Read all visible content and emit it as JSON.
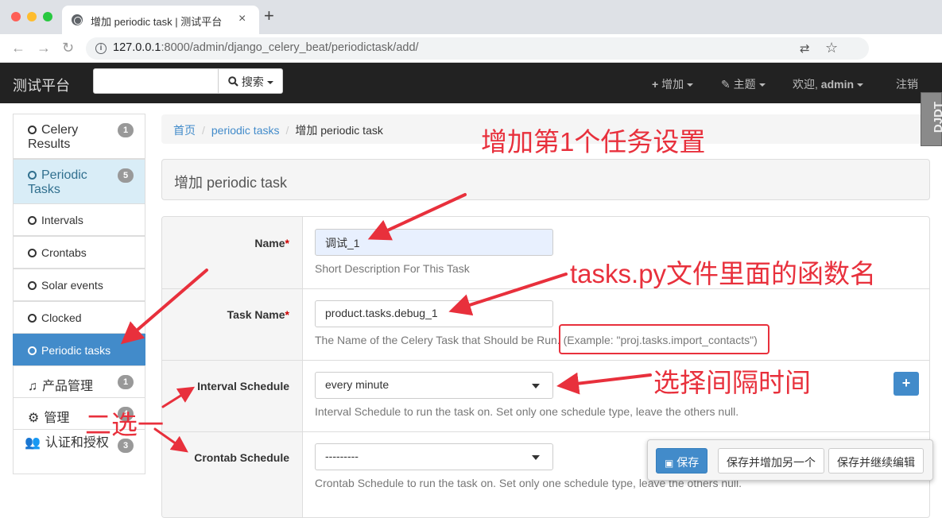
{
  "browser": {
    "tab_title": "增加 periodic task | 测试平台",
    "tab_close": "×",
    "new_tab": "+",
    "url_host": "127.0.0.1",
    "url_rest": ":8000/admin/django_celery_beat/periodictask/add/"
  },
  "navbar": {
    "brand": "测试平台",
    "search_placeholder": "",
    "search_button": "搜索",
    "add_menu": "增加",
    "theme_menu": "主题",
    "welcome": "欢迎,",
    "user": "admin",
    "logout": "注销"
  },
  "sidebar": {
    "items": [
      {
        "label": "Celery Results",
        "badge": "1"
      },
      {
        "label": "Periodic Tasks",
        "badge": "5"
      },
      {
        "label": "Intervals"
      },
      {
        "label": "Crontabs"
      },
      {
        "label": "Solar events"
      },
      {
        "label": "Clocked"
      },
      {
        "label": "Periodic tasks"
      },
      {
        "label": "产品管理",
        "badge": "1"
      },
      {
        "label": "管理",
        "badge": "4"
      },
      {
        "label": "认证和授权",
        "badge": "3"
      }
    ]
  },
  "breadcrumb": {
    "home": "首页",
    "section": "periodic tasks",
    "current": "增加 periodic task"
  },
  "page_header": "增加 periodic task",
  "form": {
    "name_label": "Name",
    "name_value": "调试_1",
    "name_help": "Short Description For This Task",
    "task_label": "Task Name",
    "task_value": "product.tasks.debug_1",
    "task_help": "The Name of the Celery Task that Should be Run.",
    "task_example": "(Example: \"proj.tasks.import_contacts\")",
    "required_mark": "*",
    "interval_label": "Interval Schedule",
    "interval_value": "every minute",
    "interval_help": "Interval Schedule to run the task on. Set only one schedule type, leave the others null.",
    "crontab_label": "Crontab Schedule",
    "crontab_value": "---------",
    "crontab_help": "Crontab Schedule to run the task on. Set only one schedule type, leave the others null.",
    "add_button": "+"
  },
  "actions": {
    "save": "保存",
    "save_add_another": "保存并增加另一个",
    "save_continue": "保存并继续编辑"
  },
  "annotations": {
    "title": "增加第1个任务设置",
    "task_note": "tasks.py文件里面的函数名",
    "interval_note": "选择间隔时间",
    "choose_one": "二选一"
  },
  "ddt_badge": "DJDT",
  "colors": {
    "annotation": "#e8303c",
    "primary": "#428bca",
    "navbar": "#222222"
  }
}
